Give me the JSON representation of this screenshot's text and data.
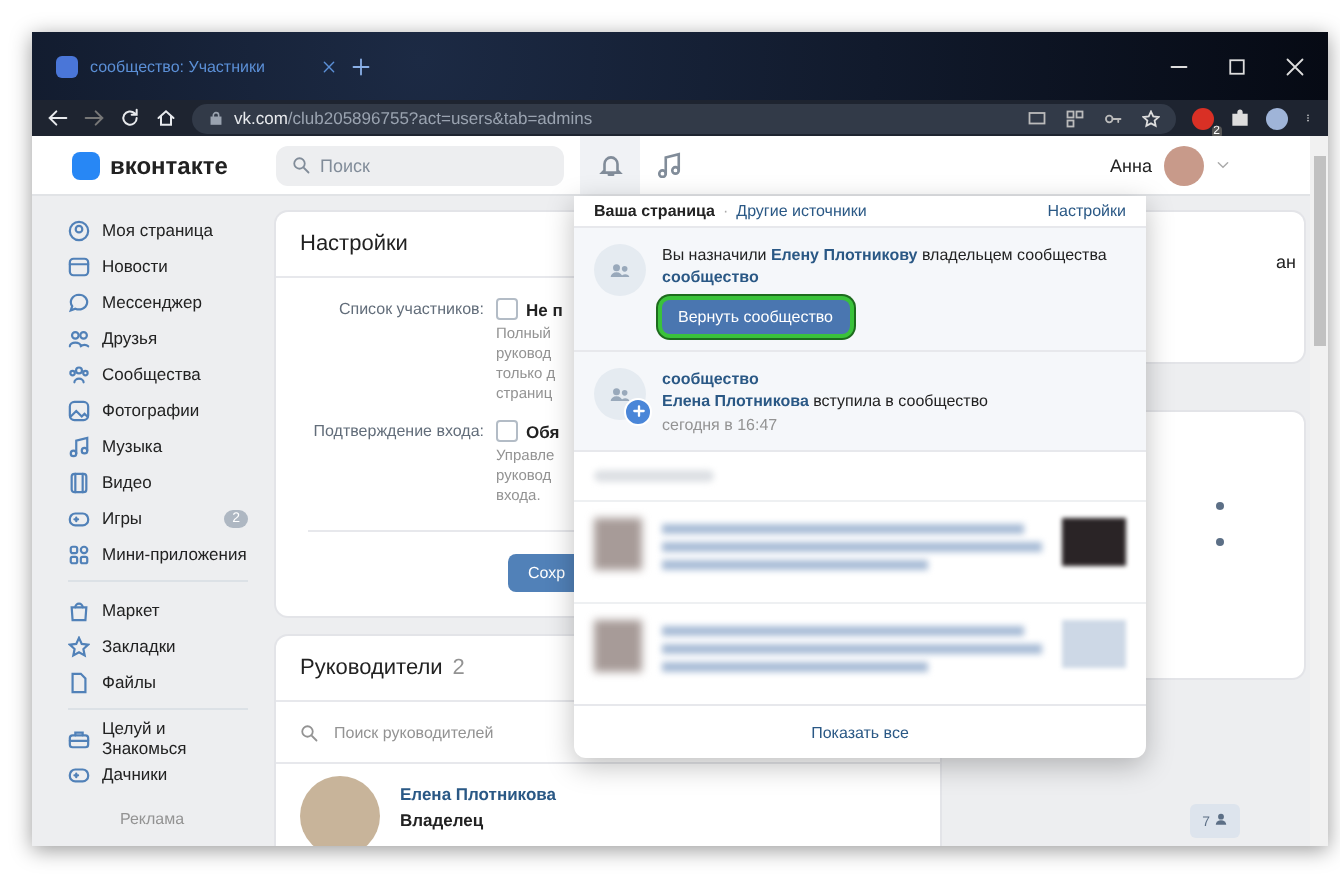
{
  "browser": {
    "tab_title": "сообщество: Участники",
    "url_host": "vk.com",
    "url_path": "/club205896755?act=users&tab=admins",
    "extension_badge": "2"
  },
  "header": {
    "logo": "вконтакте",
    "search_placeholder": "Поиск",
    "user_name": "Анна"
  },
  "sidebar": {
    "groups": [
      [
        {
          "label": "Моя страница"
        },
        {
          "label": "Новости"
        },
        {
          "label": "Мессенджер"
        },
        {
          "label": "Друзья"
        },
        {
          "label": "Сообщества"
        },
        {
          "label": "Фотографии"
        },
        {
          "label": "Музыка"
        },
        {
          "label": "Видео"
        },
        {
          "label": "Игры",
          "badge": "2"
        },
        {
          "label": "Мини-приложения"
        }
      ],
      [
        {
          "label": "Маркет"
        },
        {
          "label": "Закладки"
        },
        {
          "label": "Файлы"
        }
      ],
      [
        {
          "label": "Целуй и Знакомься"
        },
        {
          "label": "Дачники"
        }
      ]
    ],
    "footer": "Реклама"
  },
  "settings": {
    "title": "Настройки",
    "rows": [
      {
        "label": "Список участников:",
        "checked": false,
        "option": "Не п",
        "description": [
          "Полный",
          "руковод",
          "только д",
          "страниц"
        ]
      },
      {
        "label": "Подтверждение входа:",
        "checked": false,
        "option": "Обя",
        "description": [
          "Управле",
          "руковод",
          "входа."
        ]
      }
    ],
    "save_button": "Сохр"
  },
  "managers": {
    "title": "Руководители",
    "count": "2",
    "search_placeholder": "Поиск руководителей",
    "people": [
      {
        "name": "Елена Плотникова",
        "role": "Владелец"
      }
    ]
  },
  "right_panel": {
    "cut_text": "ан",
    "online_counter": "7"
  },
  "notifications": {
    "separator": "·",
    "tabs": [
      {
        "label": "Ваша страница",
        "selected": true
      },
      {
        "label": "Другие источники",
        "selected": false
      }
    ],
    "settings_link": "Настройки",
    "items": [
      {
        "kind": "owner",
        "text": "Вы назначили **Елену Плотникову** владельцем сообщества",
        "link": "сообщество",
        "button": "Вернуть сообщество"
      },
      {
        "kind": "join",
        "title": "сообщество",
        "text": "**Елена Плотникова** вступила в сообщество",
        "time": "сегодня в 16:47"
      }
    ],
    "show_all": "Показать все"
  }
}
